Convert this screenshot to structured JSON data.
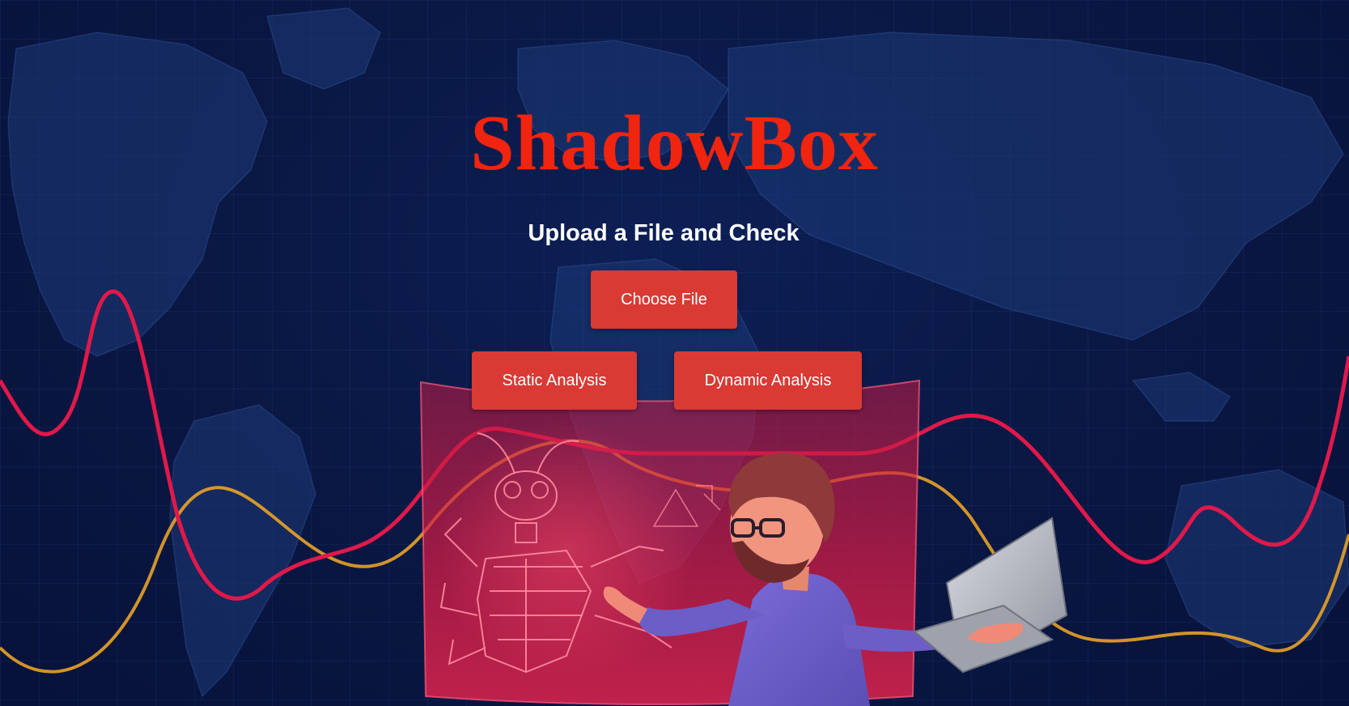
{
  "header": {
    "title": "ShadowBox",
    "subtitle": "Upload a File and Check"
  },
  "actions": {
    "choose_file_label": "Choose File",
    "static_analysis_label": "Static Analysis",
    "dynamic_analysis_label": "Dynamic Analysis"
  },
  "colors": {
    "title": "#f1240f",
    "button": "#d93a34",
    "background": "#0a1844",
    "wave_red": "#e0194a",
    "wave_orange": "#e9a227"
  },
  "illustration": {
    "icons": [
      "world-map",
      "hologram-screen",
      "bug-wireframe-icon",
      "analyst-character",
      "laptop-icon"
    ]
  }
}
